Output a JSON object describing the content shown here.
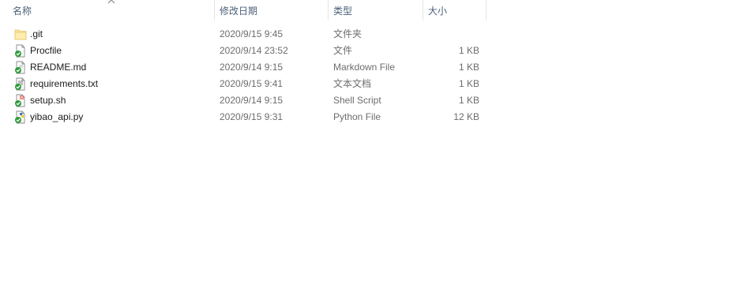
{
  "columns": {
    "name": "名称",
    "date": "修改日期",
    "type": "类型",
    "size": "大小"
  },
  "files": [
    {
      "name": ".git",
      "date": "2020/9/15 9:45",
      "type": "文件夹",
      "size": "",
      "icon": "folder-icon"
    },
    {
      "name": "Procfile",
      "date": "2020/9/14 23:52",
      "type": "文件",
      "size": "1 KB",
      "icon": "file-synced-icon"
    },
    {
      "name": "README.md",
      "date": "2020/9/14 9:15",
      "type": "Markdown File",
      "size": "1 KB",
      "icon": "markdown-file-synced-icon"
    },
    {
      "name": "requirements.txt",
      "date": "2020/9/15 9:41",
      "type": "文本文档",
      "size": "1 KB",
      "icon": "text-file-synced-icon"
    },
    {
      "name": "setup.sh",
      "date": "2020/9/14 9:15",
      "type": "Shell Script",
      "size": "1 KB",
      "icon": "shell-script-synced-icon"
    },
    {
      "name": "yibao_api.py",
      "date": "2020/9/15 9:31",
      "type": "Python File",
      "size": "12 KB",
      "icon": "python-file-synced-icon"
    }
  ],
  "colors": {
    "header_text": "#4c607a",
    "secondary_text": "#6d6d6d",
    "sync_check": "#2e9b3c",
    "folder": "#fbe39a"
  }
}
